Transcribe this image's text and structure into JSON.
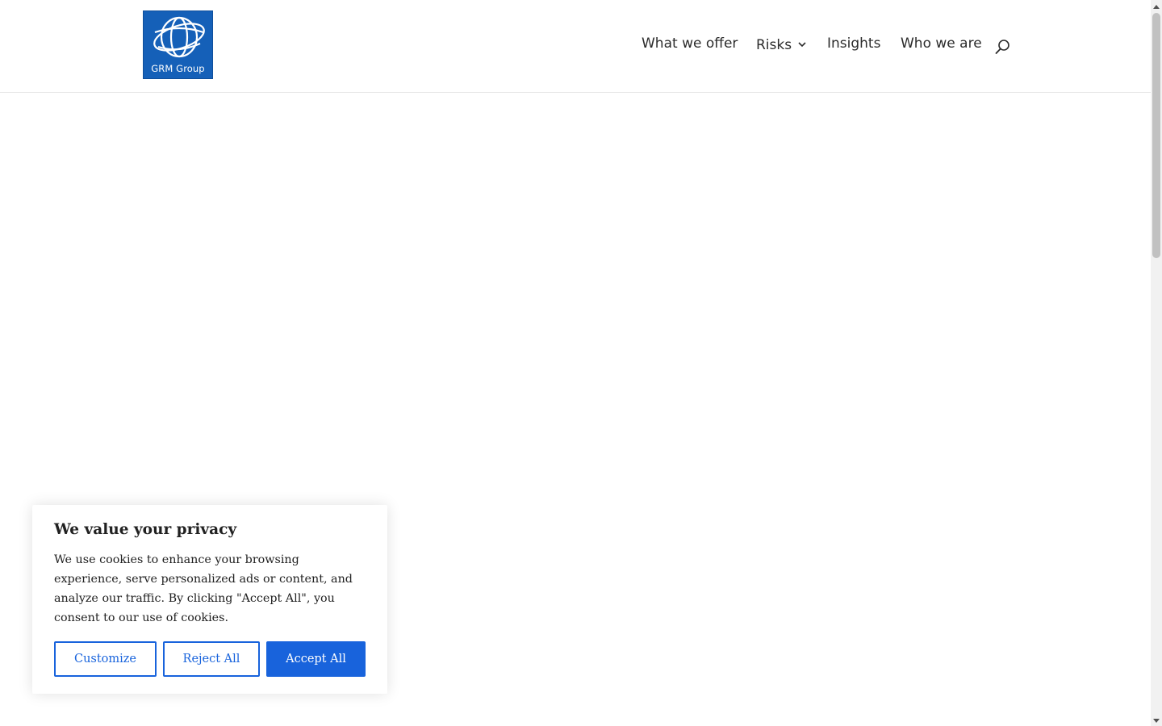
{
  "header": {
    "logo": {
      "text": "GRM Group",
      "color": "#1560b8"
    },
    "nav": [
      {
        "label": "What we offer",
        "has_dropdown": false
      },
      {
        "label": "Risks",
        "has_dropdown": true
      },
      {
        "label": "Insights",
        "has_dropdown": false
      },
      {
        "label": "Who we are",
        "has_dropdown": false
      }
    ],
    "search_icon": "search-icon"
  },
  "cookie_banner": {
    "title": "We value your privacy",
    "text": "We use cookies to enhance your browsing experience, serve personalized ads or content, and analyze our traffic. By clicking \"Accept All\", you consent to our use of cookies.",
    "customize_label": "Customize",
    "reject_label": "Reject All",
    "accept_label": "Accept All",
    "accent_color": "#1863dc"
  },
  "scrollbar": {
    "icons": [
      "scroll-up-arrow-icon",
      "scroll-down-arrow-icon"
    ]
  }
}
